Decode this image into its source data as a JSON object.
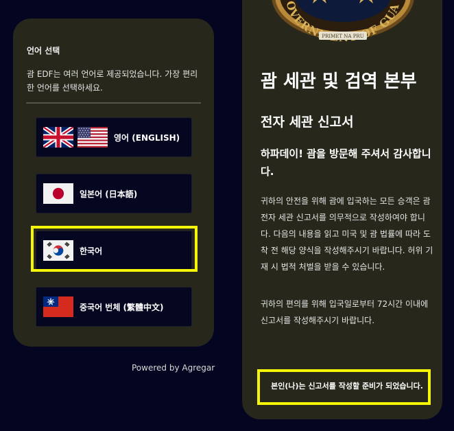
{
  "language_panel": {
    "title": "언어 선택",
    "description": "괌 EDF는 여러 언어로 제공되었습니다. 가장 편리한 언어를 선택하세요.",
    "options": [
      {
        "label": "영어 (ENGLISH)",
        "flags": [
          "uk-flag-icon",
          "us-flag-icon"
        ]
      },
      {
        "label": "일본어 (日本語)",
        "flags": [
          "japan-flag-icon"
        ]
      },
      {
        "label": "한국어",
        "flags": [
          "korea-flag-icon"
        ],
        "highlighted": true
      },
      {
        "label": "중국어 번체 (繁體中文)",
        "flags": [
          "taiwan-flag-icon"
        ]
      }
    ]
  },
  "powered_by": "Powered by Agregar",
  "info_panel": {
    "seal_text": "GOVERNMENT OF GUAM",
    "seal_ribbon": "PRIMET NA PRU",
    "title": "괌 세관 및 검역 본부",
    "subtitle": "전자 세관 신고서",
    "greeting": "하파데이! 괌을 방문해 주셔서 감사합니다.",
    "body_1": "귀하의 안전을 위해 괌에 입국하는 모든 승객은 괌 전자 세관 신고서를 의무적으로 작성하여야 합니다. 다음의 내용을 읽고 미국 및 괌 법률에 따라 도착 전 해당 양식을 작성해주시기 바랍니다. 허위 기재 시 법적 처벌을 받을 수 있습니다.",
    "body_2": "귀하의 편의를 위해 입국일로부터 72시간 이내에 신고서를 작성해주시기 바랍니다.",
    "ready_button": "본인(나)는 신고서를 작성할 준비가 되었습니다."
  },
  "colors": {
    "page_background": "#040520",
    "panel_background": "#27271c",
    "button_background": "#050620",
    "highlight": "#f5f50a"
  }
}
